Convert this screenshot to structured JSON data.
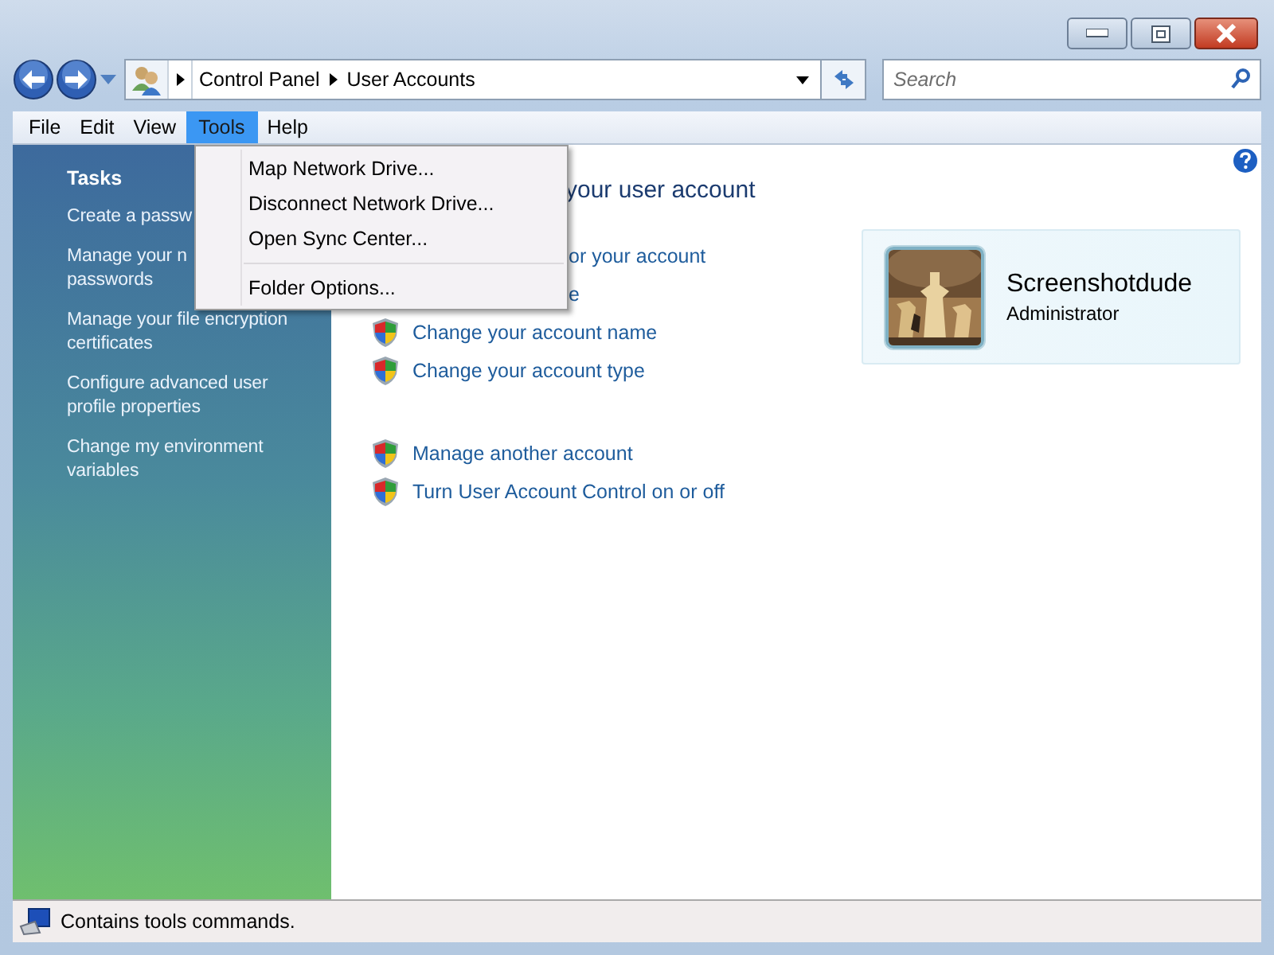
{
  "address": {
    "crumbs": [
      "Control Panel",
      "User Accounts"
    ]
  },
  "search": {
    "placeholder": "Search"
  },
  "menu_bar": [
    {
      "label": "File",
      "selected": false
    },
    {
      "label": "Edit",
      "selected": false
    },
    {
      "label": "View",
      "selected": false
    },
    {
      "label": "Tools",
      "selected": true
    },
    {
      "label": "Help",
      "selected": false
    }
  ],
  "dropdown": {
    "groups": [
      [
        "Map Network Drive...",
        "Disconnect Network Drive...",
        "Open Sync Center..."
      ],
      [
        "Folder Options..."
      ]
    ]
  },
  "sidebar": {
    "title": "Tasks",
    "links": [
      {
        "lines": [
          "Create a passw"
        ]
      },
      {
        "lines": [
          "Manage your n",
          "passwords"
        ]
      },
      {
        "lines": [
          "Manage your file encryption",
          "certificates"
        ]
      },
      {
        "lines": [
          "Configure advanced user",
          "profile properties"
        ]
      },
      {
        "lines": [
          "Change my environment",
          "variables"
        ]
      }
    ]
  },
  "main": {
    "heading": "your user account",
    "groups": [
      [
        {
          "text": "or your account",
          "shield": false
        },
        {
          "text": "e",
          "shield": false
        },
        {
          "text": "Change your account name",
          "shield": true
        },
        {
          "text": "Change your account type",
          "shield": true
        }
      ],
      [
        {
          "text": "Manage another account",
          "shield": true
        },
        {
          "text": "Turn User Account Control on or off",
          "shield": true
        }
      ]
    ]
  },
  "account": {
    "name": "Screenshotdude",
    "role": "Administrator"
  },
  "status_bar": {
    "text": "Contains tools commands."
  }
}
